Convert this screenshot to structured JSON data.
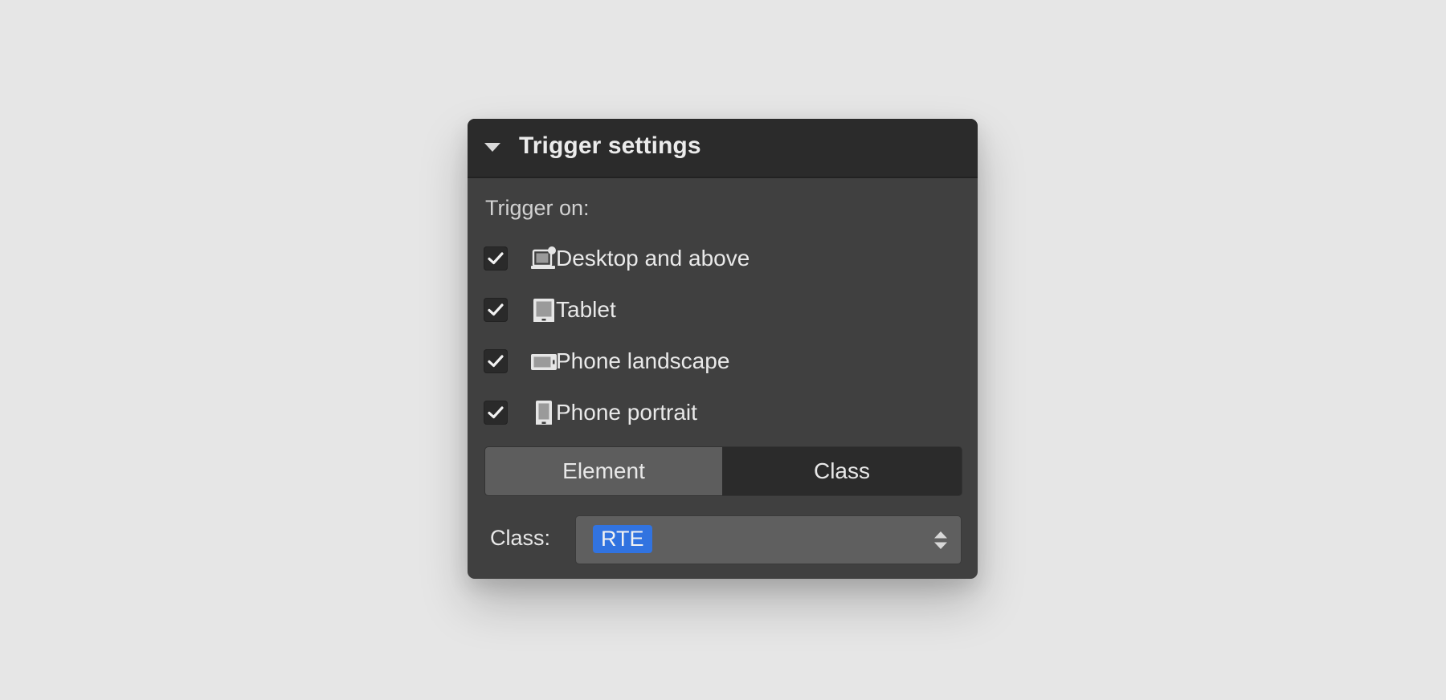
{
  "panel": {
    "title": "Trigger settings",
    "collapse_icon": "caret-down-icon",
    "trigger_on_label": "Trigger on:",
    "breakpoints": [
      {
        "label": "Desktop and above",
        "icon": "desktop-icon",
        "checked": true
      },
      {
        "label": "Tablet",
        "icon": "tablet-icon",
        "checked": true
      },
      {
        "label": "Phone landscape",
        "icon": "phone-landscape-icon",
        "checked": true
      },
      {
        "label": "Phone portrait",
        "icon": "phone-portrait-icon",
        "checked": true
      }
    ],
    "segmented": {
      "options": [
        "Element",
        "Class"
      ],
      "selected": "Class"
    },
    "class_field": {
      "label": "Class:",
      "value": "RTE",
      "chip_color": "#3173e0"
    }
  }
}
